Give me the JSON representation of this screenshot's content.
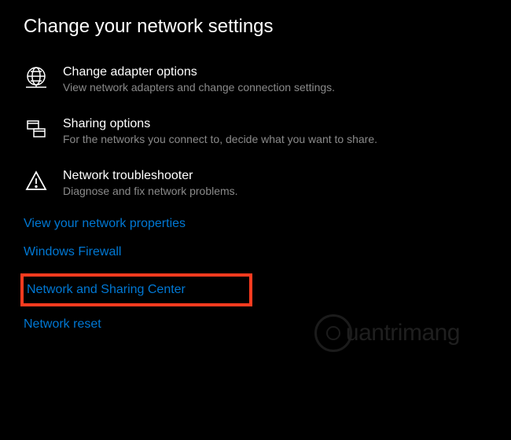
{
  "section": {
    "title": "Change your network settings"
  },
  "items": {
    "adapter": {
      "label": "Change adapter options",
      "desc": "View network adapters and change connection settings."
    },
    "sharing": {
      "label": "Sharing options",
      "desc": "For the networks you connect to, decide what you want to share."
    },
    "troubleshooter": {
      "label": "Network troubleshooter",
      "desc": "Diagnose and fix network problems."
    }
  },
  "links": {
    "properties": "View your network properties",
    "firewall": "Windows Firewall",
    "sharing_center": "Network and Sharing Center",
    "reset": "Network reset"
  },
  "watermark": {
    "text": "uantrimang"
  }
}
